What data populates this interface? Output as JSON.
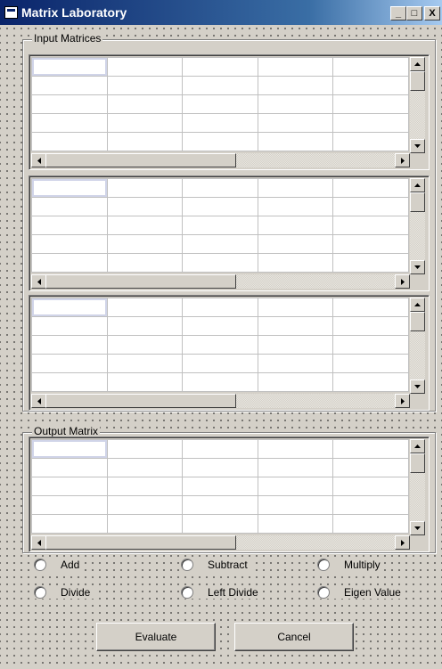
{
  "window": {
    "title": "Matrix Laboratory",
    "minimize_label": "_",
    "maximize_label": "□",
    "close_label": "X"
  },
  "input_group": {
    "label": "Input Matrices"
  },
  "output_group": {
    "label": "Output Matrix"
  },
  "operations": [
    {
      "label": "Add"
    },
    {
      "label": "Subtract"
    },
    {
      "label": "Multiply"
    },
    {
      "label": "Divide"
    },
    {
      "label": "Left Divide"
    },
    {
      "label": "Eigen Value"
    }
  ],
  "buttons": {
    "evaluate": "Evaluate",
    "cancel": "Cancel"
  }
}
